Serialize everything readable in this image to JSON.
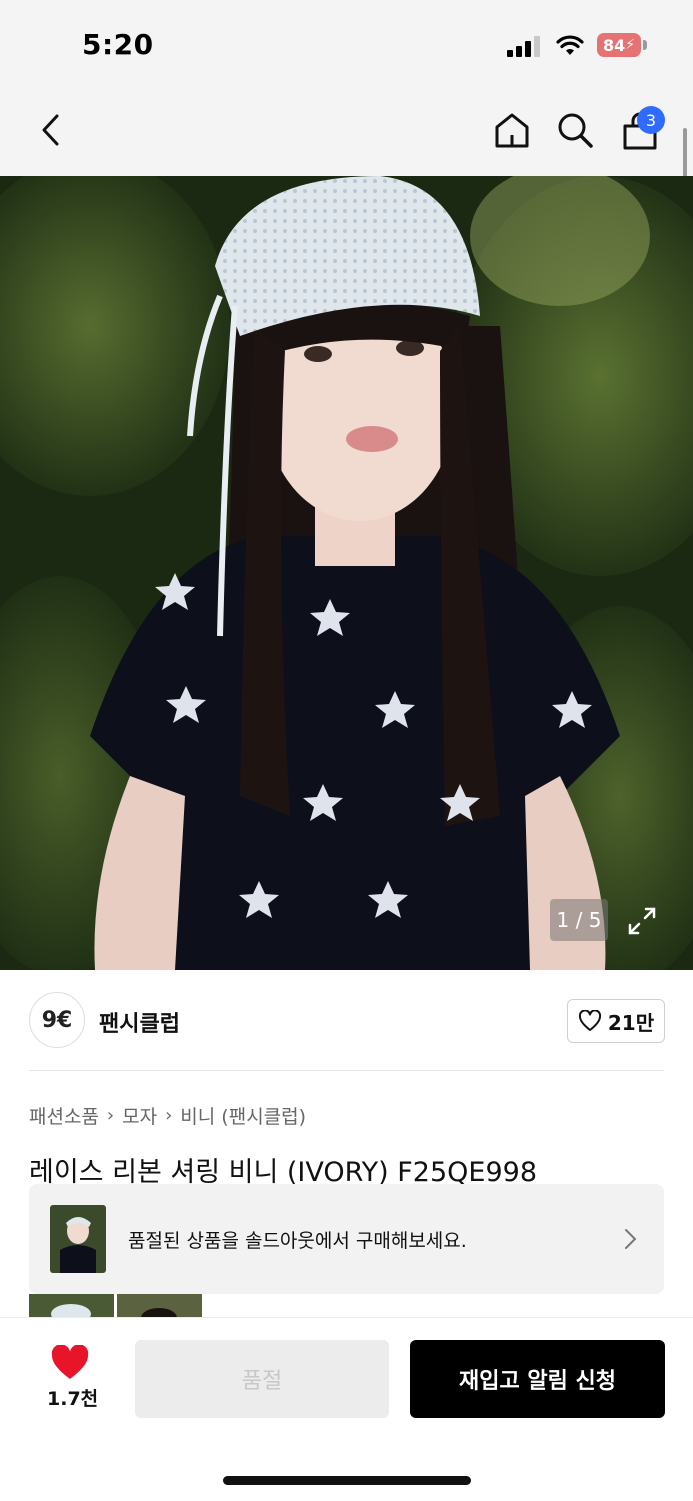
{
  "status_bar": {
    "time": "5:20",
    "battery": "84"
  },
  "nav": {
    "cart_count": "3"
  },
  "gallery": {
    "counter": "1 / 5"
  },
  "brand": {
    "logo_text": "9€",
    "name": "팬시클럽",
    "likes": "21만"
  },
  "breadcrumbs": [
    "패션소품",
    "모자",
    "비니 (팬시클럽)"
  ],
  "product": {
    "title": "레이스 리본 셔링 비니 (IVORY) F25QE998"
  },
  "soldout_banner": {
    "text": "품절된 상품을 솔드아웃에서 구매해보세요."
  },
  "bottom_bar": {
    "like_count": "1.7천",
    "soldout_label": "품절",
    "restock_label": "재입고 알림 신청"
  },
  "colors": {
    "accent_blue": "#2f6bff",
    "heart_red": "#e8142a",
    "primary_black": "#000000"
  }
}
